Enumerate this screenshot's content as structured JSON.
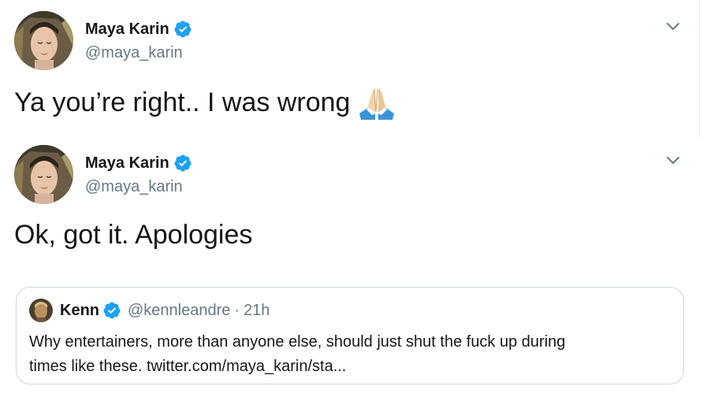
{
  "tweets": [
    {
      "author_name": "Maya Karin",
      "author_handle": "@maya_karin",
      "verified": true,
      "text": "Ya you’re right.. I was wrong",
      "emoji": "folded-hands-icon"
    },
    {
      "author_name": "Maya Karin",
      "author_handle": "@maya_karin",
      "verified": true,
      "text": "Ok, got it. Apologies",
      "quote": {
        "author_name": "Kenn",
        "author_handle": "@kennleandre",
        "separator": "·",
        "time": "21h",
        "verified": true,
        "text_line1": "Why entertainers, more than anyone else, should just shut the fuck up during",
        "text_line2": "times like these. twitter.com/maya_karin/sta..."
      }
    }
  ],
  "colors": {
    "verified_blue": "#1da1f2",
    "secondary_text": "#657786",
    "border": "#ccd6dd"
  }
}
